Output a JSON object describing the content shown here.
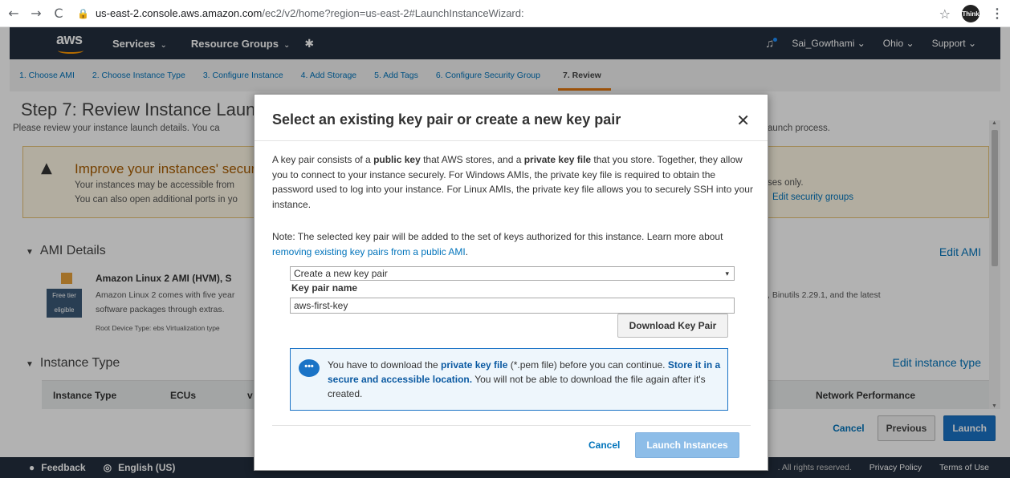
{
  "browser": {
    "back_icon": "←",
    "forward_icon": "→",
    "reload_icon": "C",
    "lock_icon": "🔒",
    "url_domain": "us-east-2.console.aws.amazon.com",
    "url_path": "/ec2/v2/home?region=us-east-2#LaunchInstanceWizard:",
    "star_icon": "☆",
    "profile_text": "Think",
    "menu_icon": "⋮"
  },
  "aws_nav": {
    "logo": "aws",
    "services": "Services",
    "resource_groups": "Resource Groups",
    "caret": "⌄",
    "pin_icon": "📌",
    "user": "Sai_Gowthami",
    "region": "Ohio",
    "support": "Support",
    "bell_icon": "🔔"
  },
  "steps": [
    "1. Choose AMI",
    "2. Choose Instance Type",
    "3. Configure Instance",
    "4. Add Storage",
    "5. Add Tags",
    "6. Configure Security Group",
    "7. Review"
  ],
  "page": {
    "title": "Step 7: Review Instance Laun",
    "subtitle": "Please review your instance launch details. You ca",
    "subtitle_right": "aunch process.",
    "warning": {
      "icon": "▲",
      "title": "Improve your instances' securi",
      "line1": "Your instances may be accessible from",
      "line2": "You can also open additional ports in yo",
      "right1": "ses only.",
      "right2": "Edit security groups"
    },
    "ami_section": "AMI Details",
    "edit_ami": "Edit AMI",
    "ami_name": "Amazon Linux 2 AMI (HVM), S",
    "free_tier_1": "Free tier",
    "free_tier_2": "eligible",
    "ami_desc1": "Amazon Linux 2 comes with five year",
    "ami_desc2": "software packages through extras.",
    "ami_meta": "Root Device Type: ebs    Virtualization type",
    "ami_right": ", Binutils 2.29.1, and the latest",
    "instance_section": "Instance Type",
    "edit_instance": "Edit instance type",
    "table_headers": [
      "Instance Type",
      "ECUs",
      "v",
      "Network Performance"
    ],
    "cancel": "Cancel",
    "previous": "Previous",
    "launch": "Launch"
  },
  "footer": {
    "feedback": "Feedback",
    "language": "English (US)",
    "rights": ". All rights reserved.",
    "privacy": "Privacy Policy",
    "terms": "Terms of Use"
  },
  "modal": {
    "title": "Select an existing key pair or create a new key pair",
    "close_icon": "✕",
    "body_parts": {
      "p1": "A key pair consists of a ",
      "b1": "public key",
      "p2": " that AWS stores, and a ",
      "b2": "private key file",
      "p3": " that you store. Together, they allow you to connect to your instance securely. For Windows AMIs, the private key file is required to obtain the password used to log into your instance. For Linux AMIs, the private key file allows you to securely SSH into your instance."
    },
    "note_text": "Note: The selected key pair will be added to the set of keys authorized for this instance. Learn more about ",
    "note_link": "removing existing key pairs from a public AMI",
    "note_end": ".",
    "select_value": "Create a new key pair",
    "select_arrow": "▾",
    "key_pair_label": "Key pair name",
    "key_pair_value": "aws-first-key",
    "download_button": "Download Key Pair",
    "info_icon": "•••",
    "info": {
      "t1": "You have to download the ",
      "b1": "private key file",
      "t2": " (*.pem file) before you can continue. ",
      "b2": "Store it in a secure and accessible location.",
      "t3": " You will not be able to download the file again after it's created."
    },
    "cancel": "Cancel",
    "launch_instances": "Launch Instances"
  }
}
